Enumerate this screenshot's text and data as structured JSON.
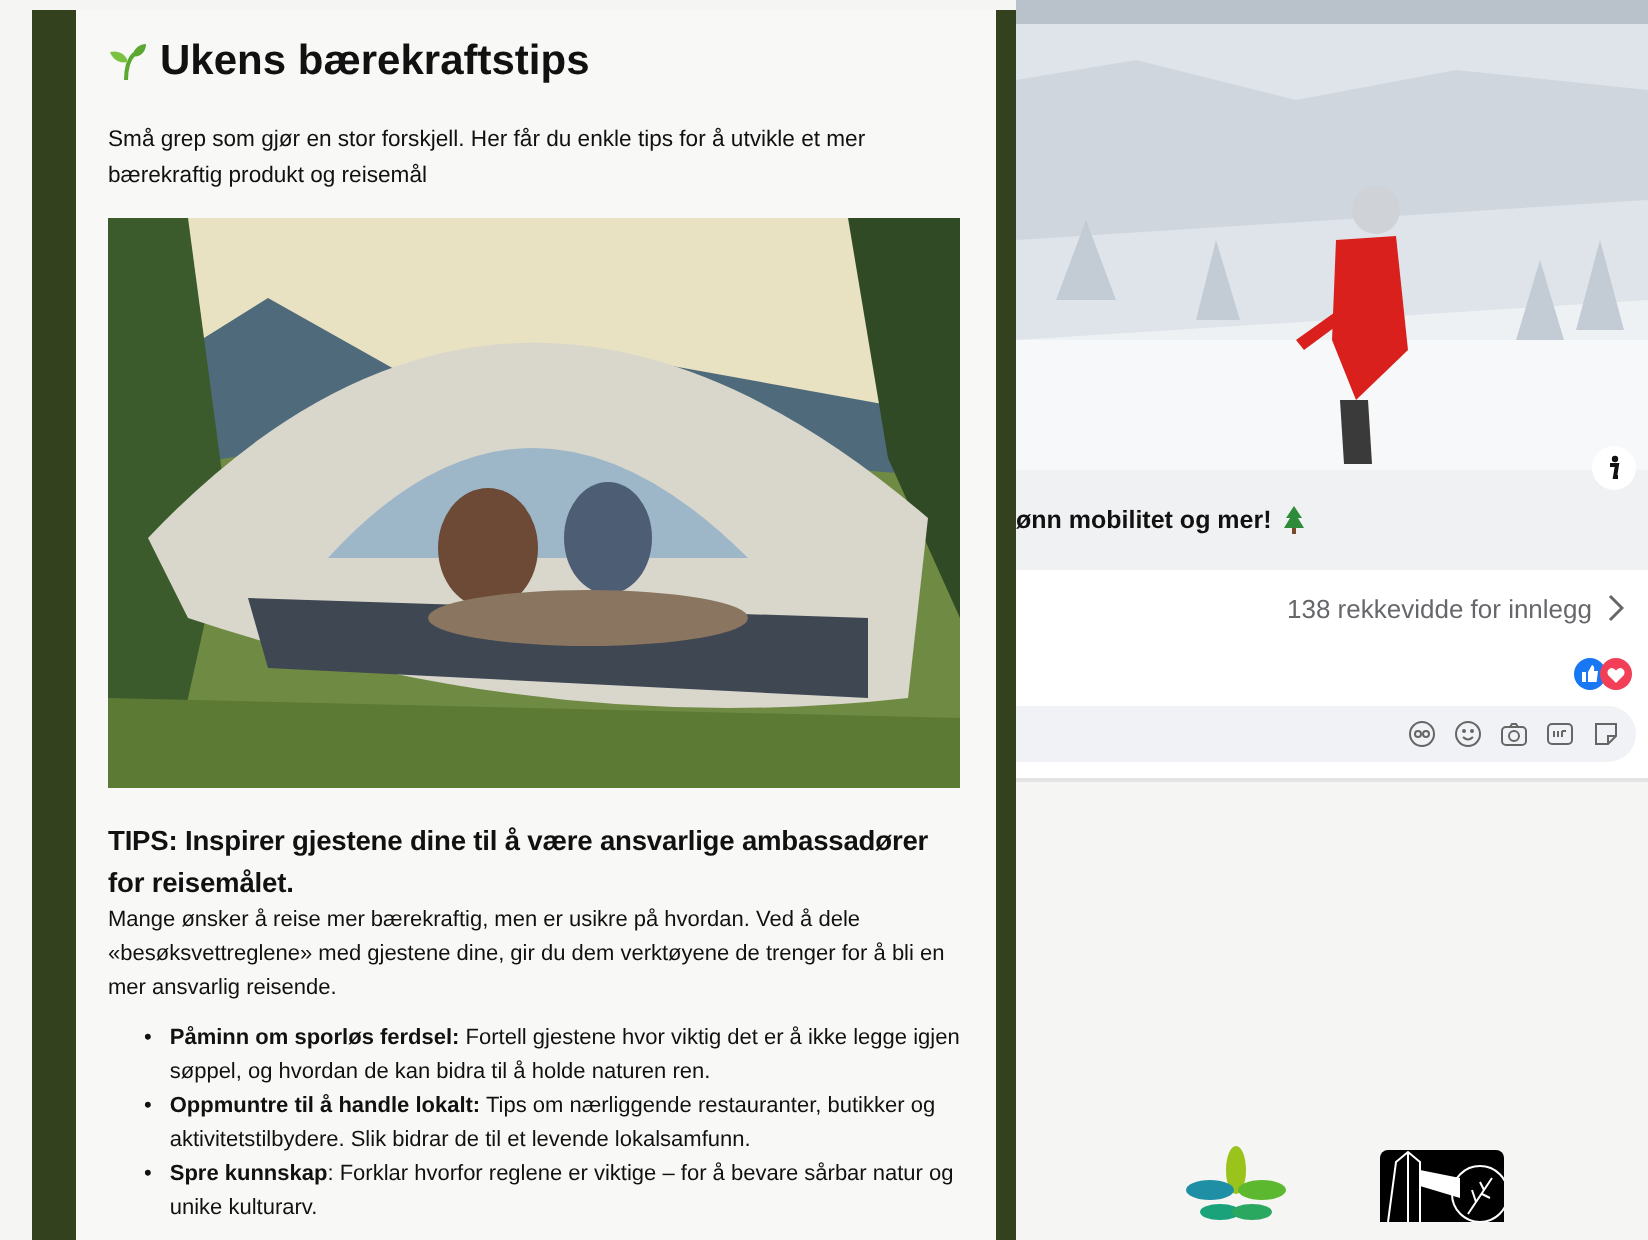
{
  "newsletter": {
    "title": "Ukens bærekraftstips",
    "intro": "Små grep som gjør en stor forskjell. Her får du enkle tips for å utvikle et mer bærekraftig produkt og reisemål",
    "tip_heading": "TIPS: Inspirer gjestene dine til å være ansvarlige ambassadører for reisemålet.",
    "body": "Mange ønsker å reise mer bærekraftig, men er usikre på hvordan. Ved å dele «besøksvettreglene» med gjestene dine, gir du dem verktøyene de trenger for å bli en mer ansvarlig reisende.",
    "bullets": [
      {
        "marker": "•",
        "text": "**Påminn om sporløs ferdsel:** Fortell gjestene hvor viktig det er å ikke legge igjen søppel, og hvordan de kan bidra til å holde naturen ren."
      },
      {
        "marker": "•",
        "text": "**Oppmuntre til å handle lokalt:** Tips om nærliggende restauranter, butikker og aktivitetstilbydere. Slik bidrar de til et levende lokalsamfunn."
      },
      {
        "marker": "•",
        "text": "**Spre kunnskap**: Forklar hvorfor reglene er viktige – for å bevare sårbar natur og unike kulturarv."
      }
    ]
  },
  "post": {
    "caption": "ønn mobilitet og mer!",
    "reach": "138 rekkevidde for innlegg"
  }
}
